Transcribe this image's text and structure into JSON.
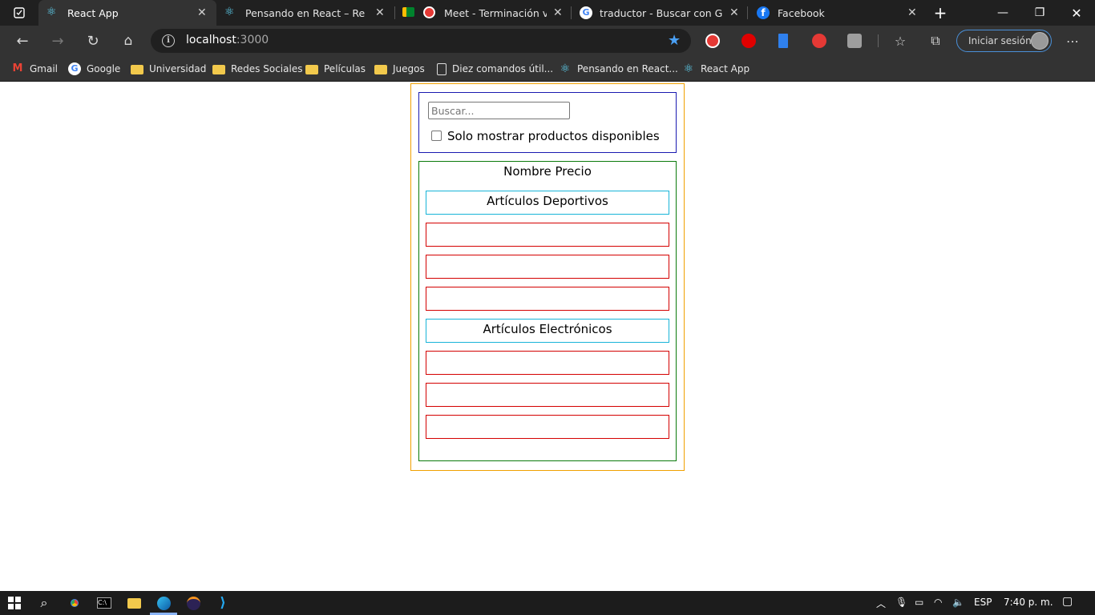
{
  "browser": {
    "tabs": [
      {
        "title": "React App",
        "icon": "react-icon",
        "active": true
      },
      {
        "title": "Pensando en React – React",
        "icon": "react-icon",
        "active": false
      },
      {
        "title": "Meet - Terminación vista",
        "icon": "meet-icon",
        "active": false
      },
      {
        "title": "traductor - Buscar con Googl",
        "icon": "google-icon",
        "active": false
      },
      {
        "title": "Facebook",
        "icon": "facebook-icon",
        "active": false
      }
    ],
    "address": {
      "host": "localhost",
      "port": ":3000"
    },
    "signin_label": "Iniciar sesión",
    "bookmarks": [
      {
        "label": "Gmail",
        "icon": "gmail-icon"
      },
      {
        "label": "Google",
        "icon": "google-icon"
      },
      {
        "label": "Universidad",
        "icon": "folder-icon"
      },
      {
        "label": "Redes Sociales",
        "icon": "folder-icon"
      },
      {
        "label": "Películas",
        "icon": "folder-icon"
      },
      {
        "label": "Juegos",
        "icon": "folder-icon"
      },
      {
        "label": "Diez comandos útil...",
        "icon": "page-icon"
      },
      {
        "label": "Pensando en React...",
        "icon": "react-icon"
      },
      {
        "label": "React App",
        "icon": "react-icon"
      }
    ]
  },
  "app": {
    "search": {
      "placeholder": "Buscar...",
      "value": ""
    },
    "stock_only": {
      "label": "Solo mostrar productos disponibles",
      "checked": false
    },
    "table_header": "Nombre Precio",
    "categories": [
      {
        "name": "Artículos Deportivos",
        "products": [
          "",
          "",
          ""
        ]
      },
      {
        "name": "Artículos Electrónicos",
        "products": [
          "",
          "",
          ""
        ]
      }
    ]
  },
  "taskbar": {
    "language": "ESP",
    "time": "7:40 p. m."
  },
  "colors": {
    "app_border": "#f0a000",
    "searchbar_border": "#1a1ab0",
    "table_border": "#0a7a0a",
    "category_border": "#18b4d8",
    "product_border": "#d40000"
  }
}
